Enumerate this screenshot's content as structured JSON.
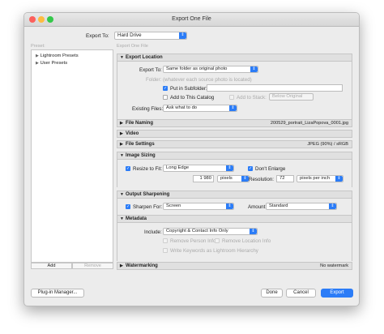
{
  "window": {
    "title": "Export One File"
  },
  "export_to": {
    "label": "Export To:",
    "value": "Hard Drive"
  },
  "preset": {
    "header": "Preset:",
    "items": [
      "Lightroom Presets",
      "User Presets"
    ],
    "add_label": "Add",
    "remove_label": "Remove"
  },
  "right_header": "Export One File",
  "export_location": {
    "title": "Export Location",
    "export_to_label": "Export To:",
    "export_to_value": "Same folder as original photo",
    "folder_label": "Folder:",
    "folder_value": "(whatever each source photo is located)",
    "subfolder_label": "Put in Subfolder:",
    "add_catalog_label": "Add to This Catalog",
    "add_stack_label": "Add to Stack:",
    "stack_value": "Below Original",
    "existing_label": "Existing Files:",
    "existing_value": "Ask what to do"
  },
  "file_naming": {
    "title": "File Naming",
    "note": "200529_portrait_LizaPopova_0001.jpg"
  },
  "video": {
    "title": "Video"
  },
  "file_settings": {
    "title": "File Settings",
    "note": "JPEG (90%) / sRGB"
  },
  "image_sizing": {
    "title": "Image Sizing",
    "resize_label": "Resize to Fit:",
    "resize_value": "Long Edge",
    "dont_enlarge_label": "Don't Enlarge",
    "size_value": "1 980",
    "size_unit": "pixels",
    "resolution_label": "Resolution:",
    "resolution_value": "72",
    "resolution_unit": "pixels per inch"
  },
  "output_sharpening": {
    "title": "Output Sharpening",
    "sharpen_label": "Sharpen For:",
    "sharpen_value": "Screen",
    "amount_label": "Amount:",
    "amount_value": "Standard"
  },
  "metadata": {
    "title": "Metadata",
    "include_label": "Include:",
    "include_value": "Copyright & Contact Info Only",
    "remove_person_label": "Remove Person Info",
    "remove_location_label": "Remove Location Info",
    "write_keywords_label": "Write Keywords as Lightroom Hierarchy"
  },
  "watermarking": {
    "title": "Watermarking",
    "note": "No watermark"
  },
  "buttons": {
    "plugin_manager": "Plug-in Manager...",
    "done": "Done",
    "cancel": "Cancel",
    "export": "Export"
  },
  "colors": {
    "accent": "#2b7cf7",
    "close": "#fc605c",
    "minimize": "#fdbc40",
    "zoom": "#34c84a"
  }
}
